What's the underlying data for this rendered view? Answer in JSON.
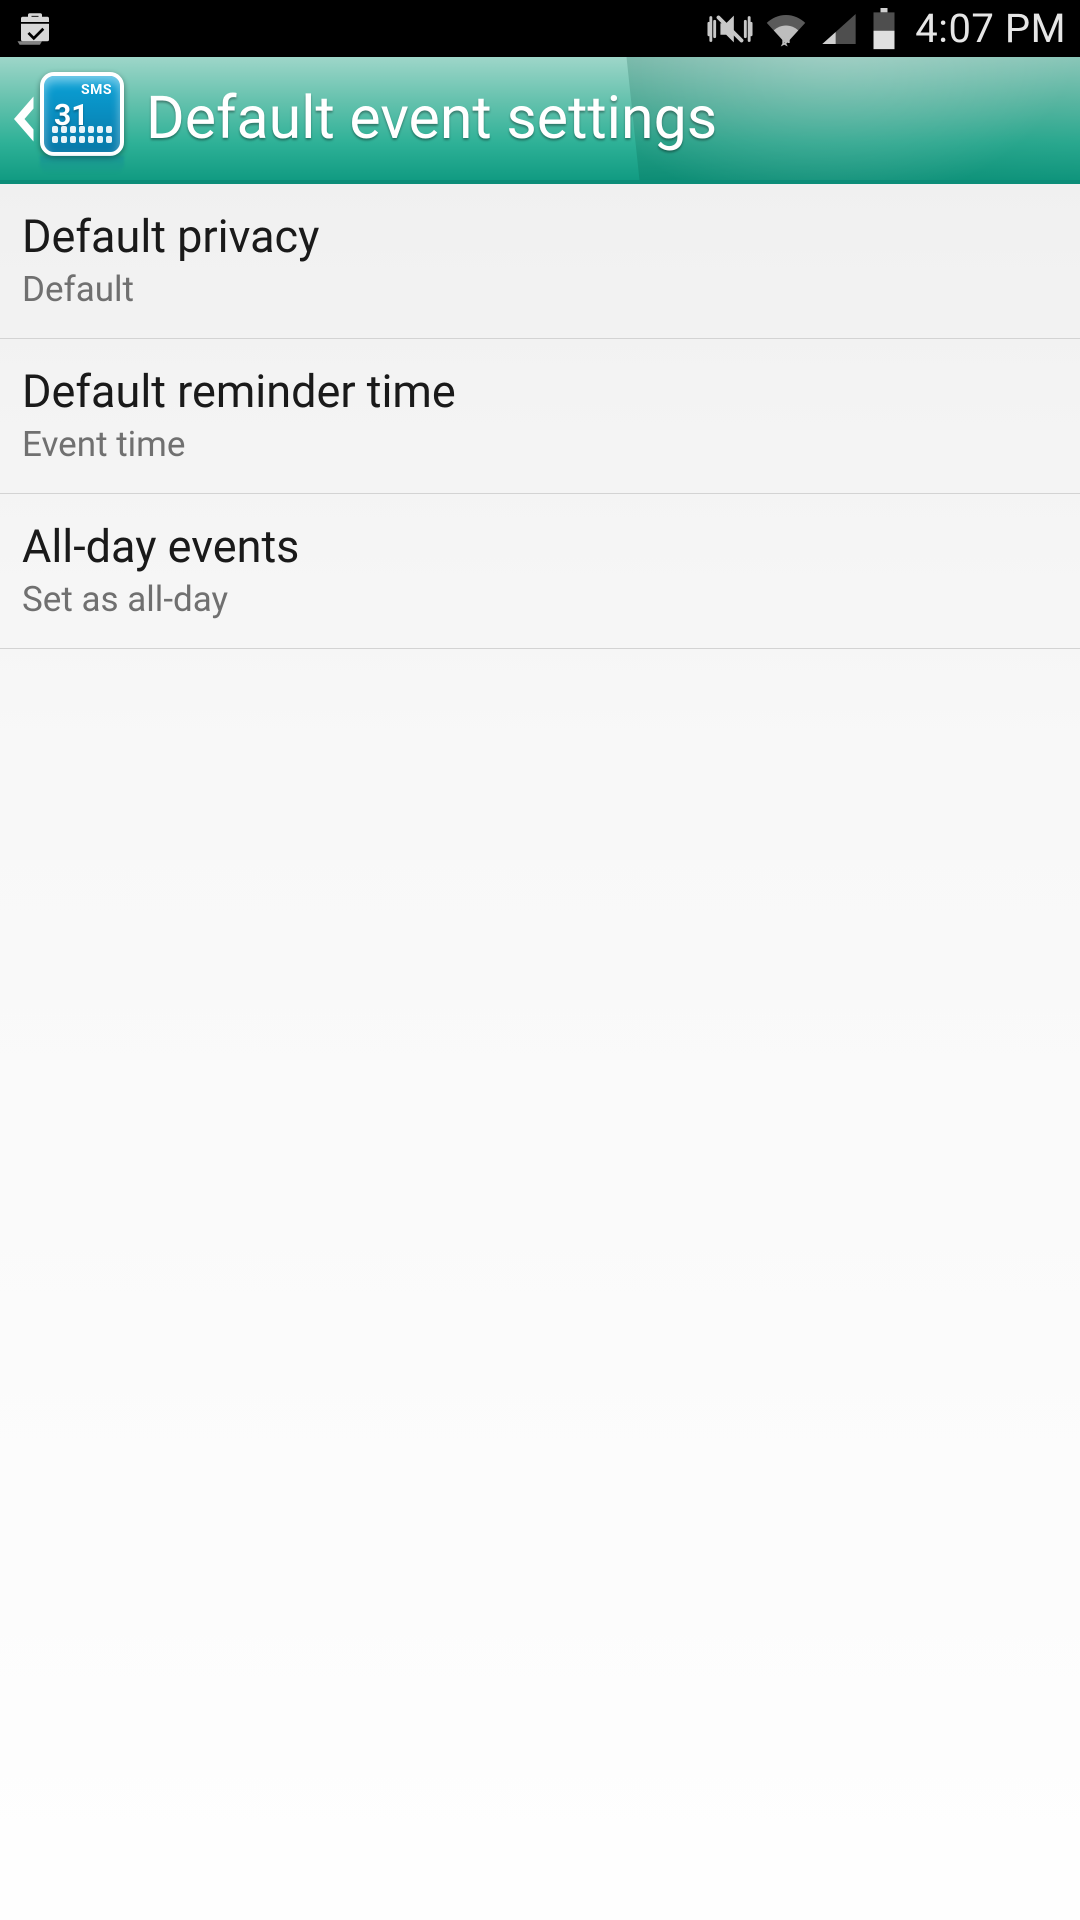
{
  "status_bar": {
    "time": "4:07 PM"
  },
  "header": {
    "title": "Default event settings",
    "icon_label_top": "SMS",
    "icon_label_num": "31"
  },
  "settings": [
    {
      "title": "Default privacy",
      "subtitle": "Default"
    },
    {
      "title": "Default reminder time",
      "subtitle": "Event time"
    },
    {
      "title": "All-day events",
      "subtitle": "Set as all-day"
    }
  ]
}
